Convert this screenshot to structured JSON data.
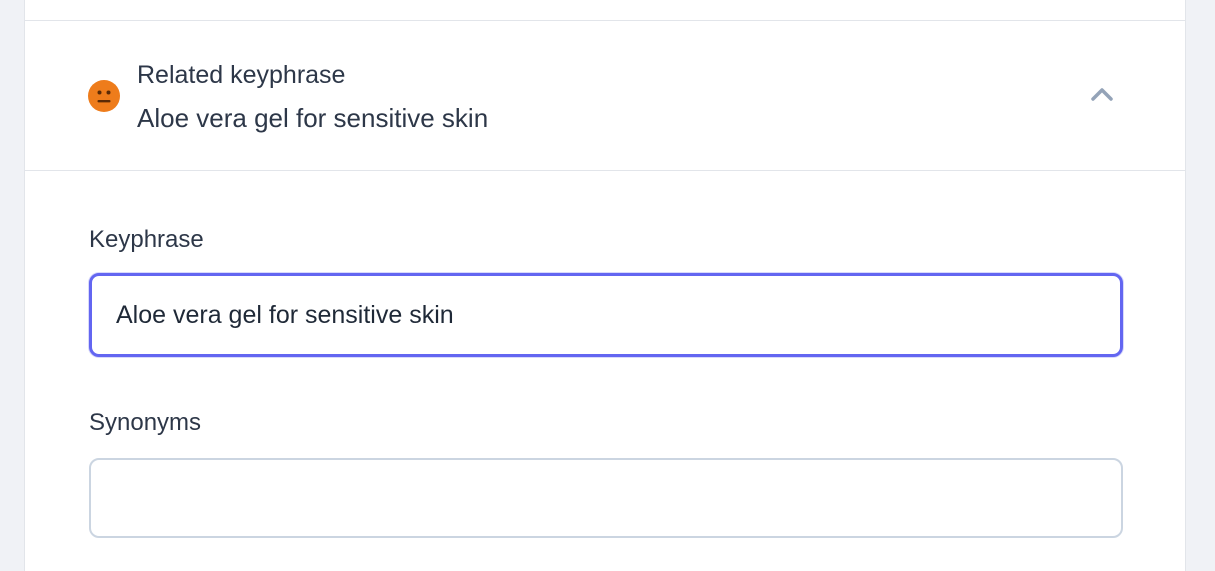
{
  "related_keyphrase": {
    "title": "Related keyphrase",
    "subtitle": "Aloe vera gel for sensitive skin",
    "score_icon": "neutral-face-icon",
    "score_color": "#ee7c1b",
    "expand_icon": "chevron-up-icon"
  },
  "form": {
    "keyphrase_label": "Keyphrase",
    "keyphrase_value": "Aloe vera gel for sensitive skin",
    "synonyms_label": "Synonyms",
    "synonyms_value": ""
  },
  "colors": {
    "focus_ring": "#6366f1",
    "page_background": "#f0f2f6"
  }
}
